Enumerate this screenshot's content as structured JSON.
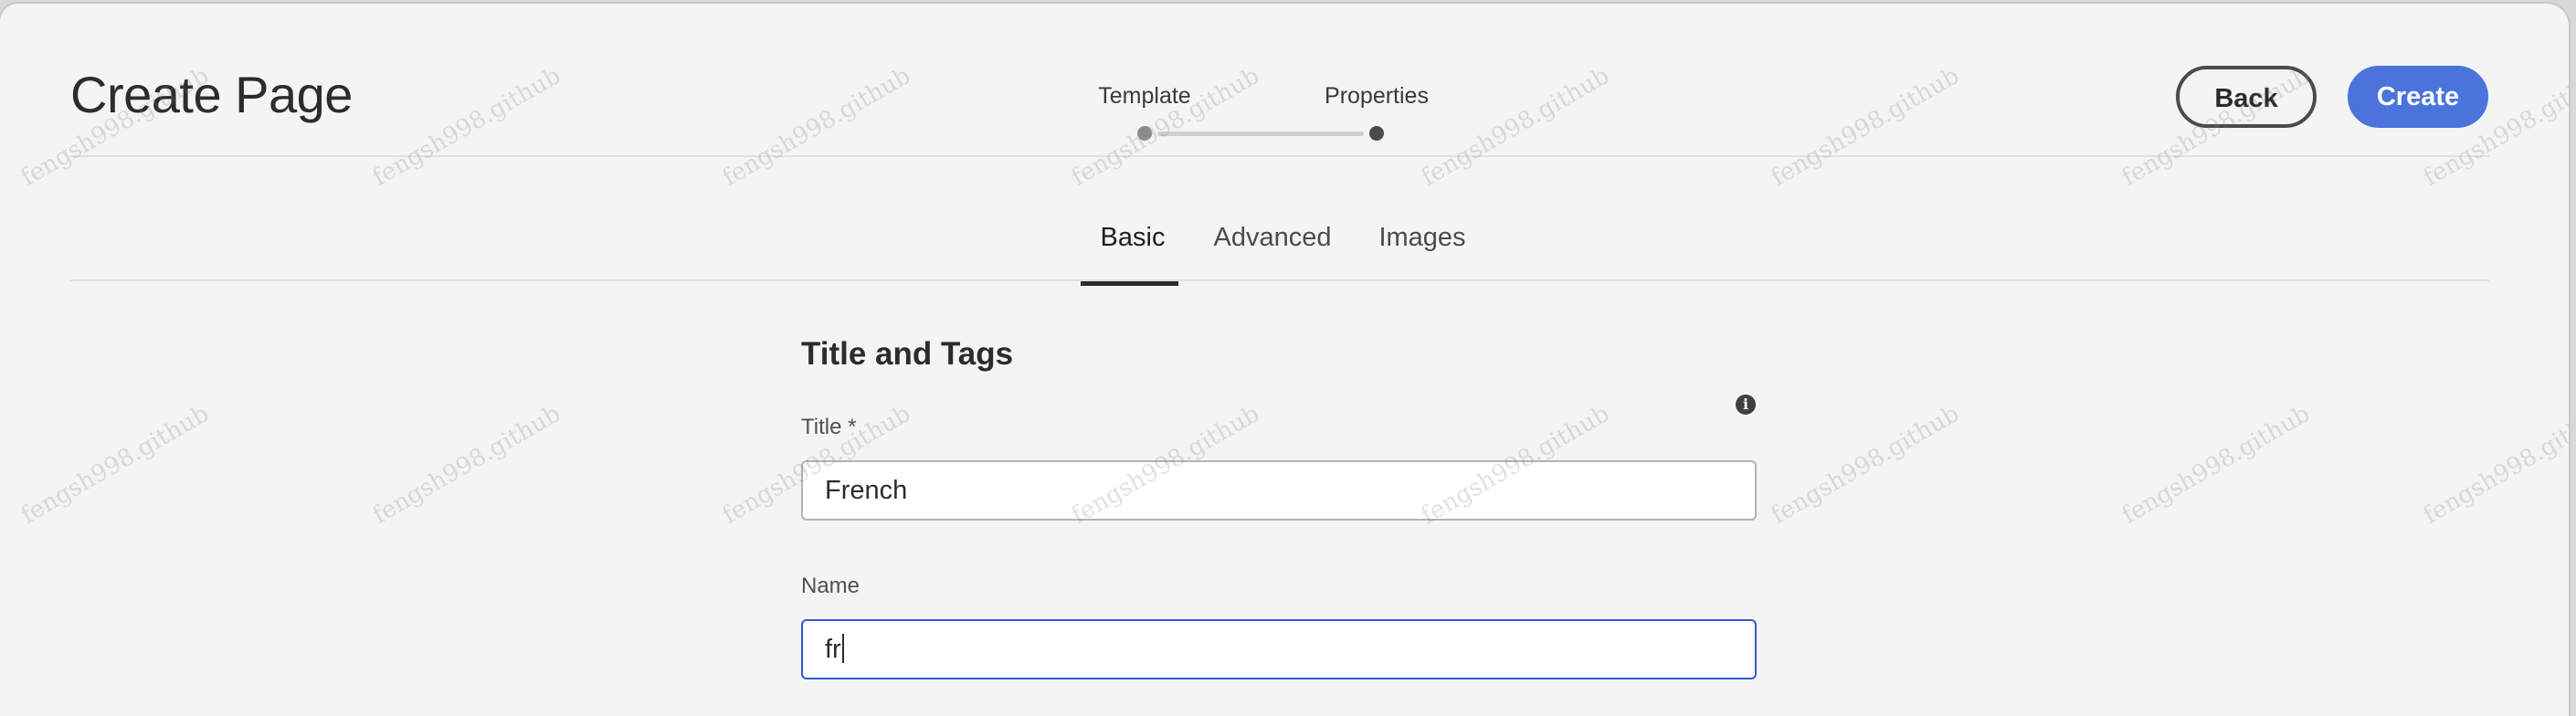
{
  "dialog": {
    "title": "Create Page",
    "back_label": "Back",
    "create_label": "Create"
  },
  "stepper": {
    "steps": [
      {
        "label": "Template",
        "status": "completed"
      },
      {
        "label": "Properties",
        "status": "current"
      }
    ]
  },
  "tabs": [
    {
      "label": "Basic",
      "active": true
    },
    {
      "label": "Advanced",
      "active": false
    },
    {
      "label": "Images",
      "active": false
    }
  ],
  "form": {
    "section_title": "Title and Tags",
    "info_icon": "info-icon",
    "title_field": {
      "label": "Title *",
      "value": "French"
    },
    "name_field": {
      "label": "Name",
      "value": "fr"
    }
  },
  "watermark": "fengsh998.github",
  "colors": {
    "accent": "#4a74dc",
    "focus": "#2f5bd1",
    "background": "#f4f4f4"
  }
}
